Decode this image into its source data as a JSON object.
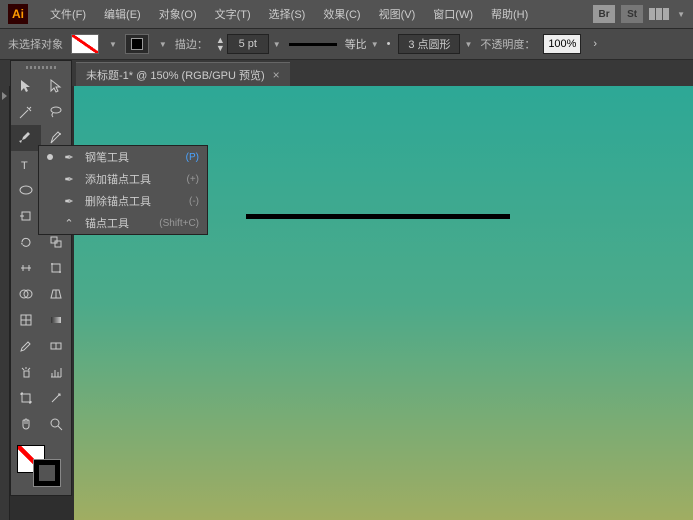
{
  "app": {
    "logo": "Ai"
  },
  "menu": {
    "file": "文件(F)",
    "edit": "编辑(E)",
    "object": "对象(O)",
    "type": "文字(T)",
    "select": "选择(S)",
    "effect": "效果(C)",
    "view": "视图(V)",
    "window": "窗口(W)",
    "help": "帮助(H)"
  },
  "menu_right": {
    "br": "Br",
    "st": "St"
  },
  "control": {
    "no_selection": "未选择对象",
    "stroke_label": "描边：",
    "stroke_value": "5 pt",
    "scale_label": "等比",
    "profile_value": "3 点圆形",
    "opacity_label": "不透明度：",
    "opacity_value": "100%"
  },
  "tab": {
    "title": "未标题-1* @ 150% (RGB/GPU 预览)"
  },
  "flyout": {
    "items": [
      {
        "label": "钢笔工具",
        "shortcut": "(P)",
        "selected": true,
        "icon": "✒"
      },
      {
        "label": "添加锚点工具",
        "shortcut": "(+)",
        "selected": false,
        "icon": "✒"
      },
      {
        "label": "删除锚点工具",
        "shortcut": "(-)",
        "selected": false,
        "icon": "✒"
      },
      {
        "label": "锚点工具",
        "shortcut": "(Shift+C)",
        "selected": false,
        "icon": "⌃"
      }
    ]
  }
}
